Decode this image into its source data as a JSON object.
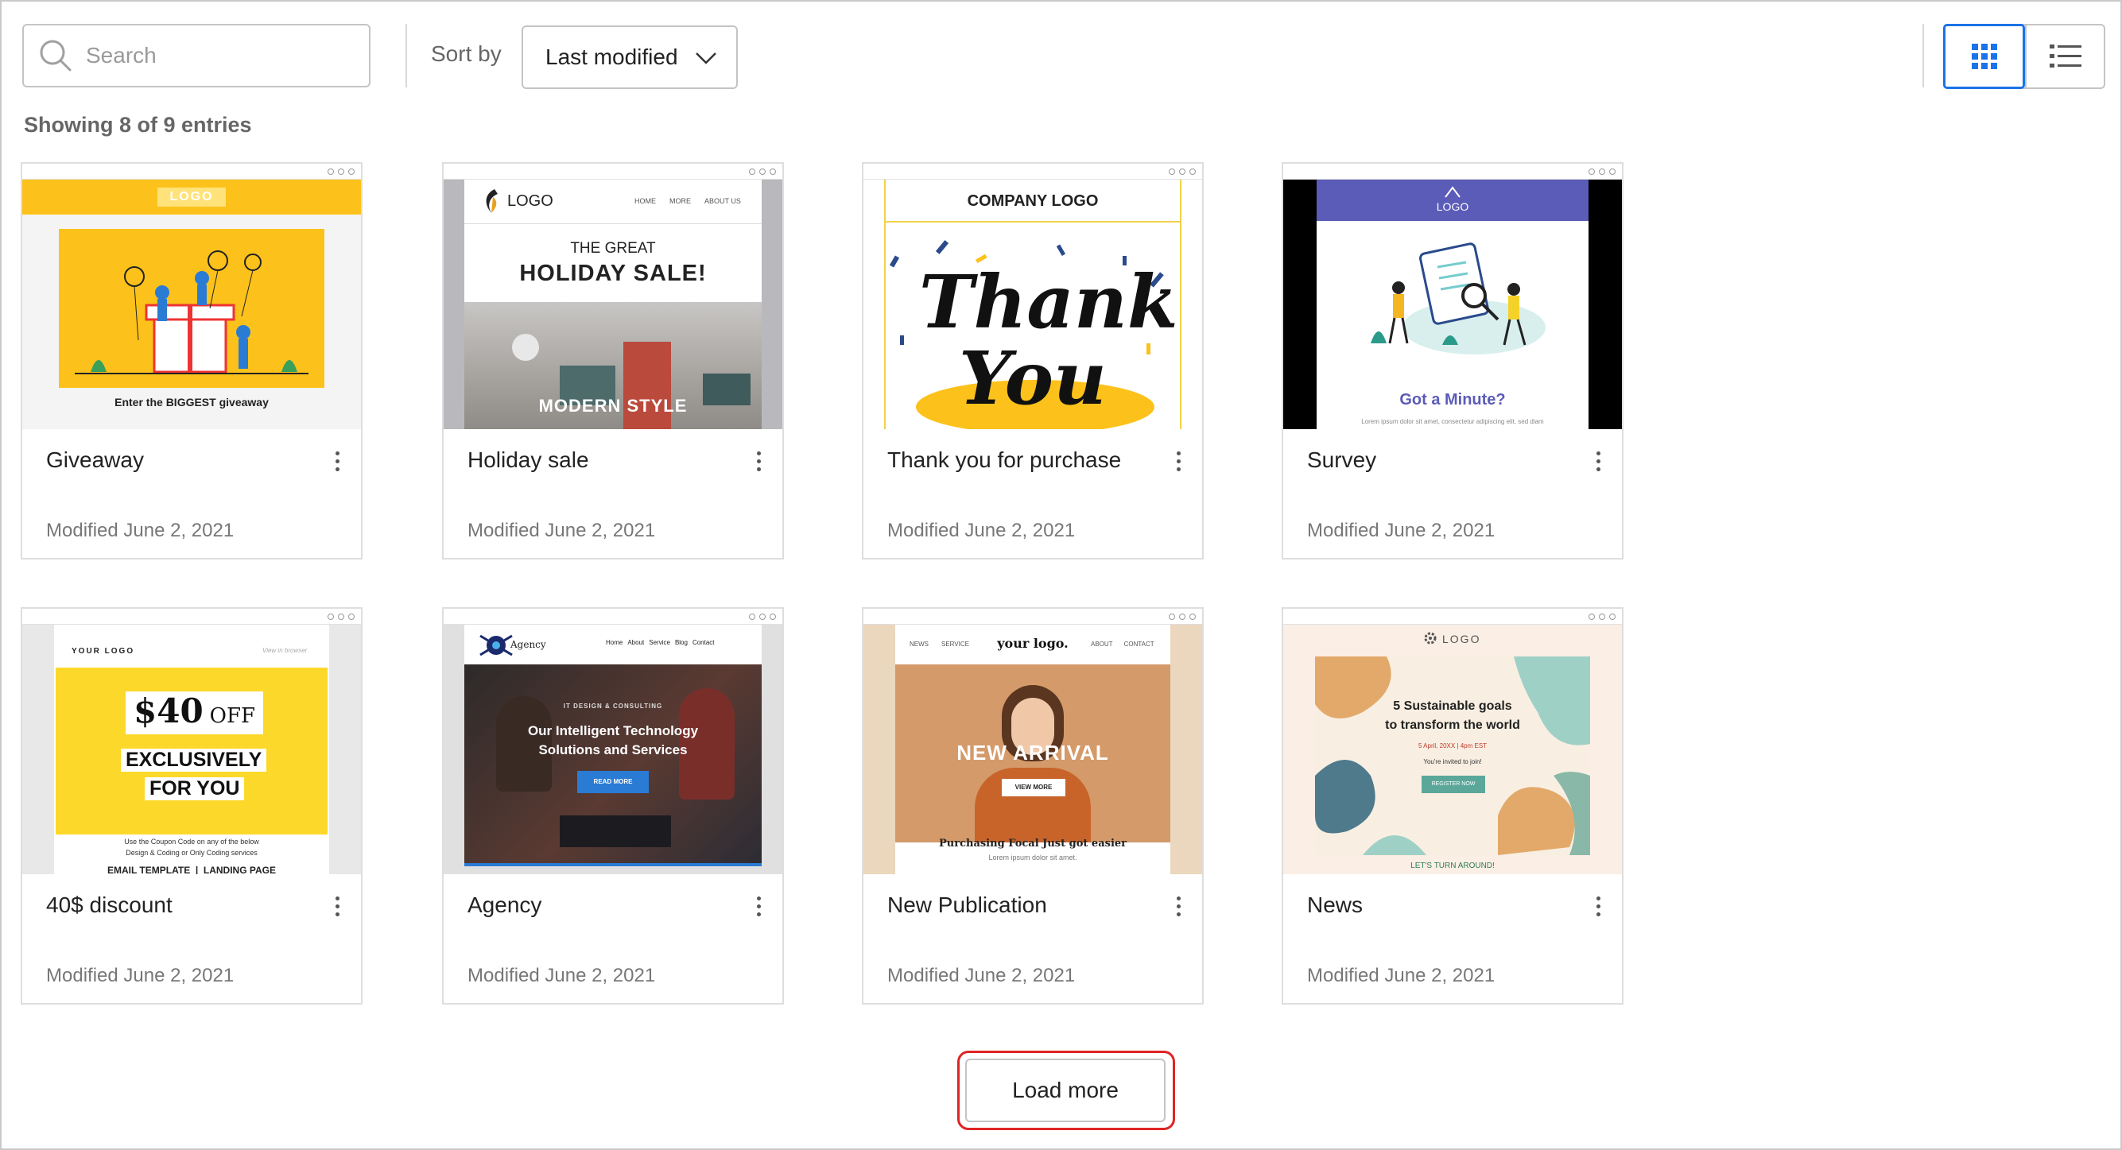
{
  "toolbar": {
    "search_placeholder": "Search",
    "sort_label": "Sort by",
    "sort_value": "Last modified"
  },
  "summary": {
    "count_text": "Showing 8 of 9 entries"
  },
  "colors": {
    "accent": "#1a73e8",
    "highlight": "#e02424"
  },
  "cards": [
    {
      "title": "Giveaway",
      "modified": "Modified June 2, 2021",
      "preview": {
        "logo": "LOGO",
        "caption": "Enter the BIGGEST giveaway"
      }
    },
    {
      "title": "Holiday sale",
      "modified": "Modified June 2, 2021",
      "preview": {
        "logo": "LOGO",
        "nav": [
          "HOME",
          "MORE",
          "ABOUT US"
        ],
        "line1": "THE GREAT",
        "line2": "HOLIDAY SALE!",
        "banner": "MODERN STYLE"
      }
    },
    {
      "title": "Thank you for purchase",
      "modified": "Modified June 2, 2021",
      "preview": {
        "logo": "COMPANY LOGO",
        "word1": "Thank",
        "word2": "You"
      }
    },
    {
      "title": "Survey",
      "modified": "Modified June 2, 2021",
      "preview": {
        "logo": "LOGO",
        "headline": "Got a Minute?",
        "body": "Lorem ipsum dolor sit amet, consectetur adipiscing elit, sed diam"
      }
    },
    {
      "title": "40$ discount",
      "modified": "Modified June 2, 2021",
      "preview": {
        "logo": "YOUR LOGO",
        "link": "View in browser",
        "price": "$40",
        "off": "OFF",
        "line1": "EXCLUSIVELY",
        "line2": "FOR YOU",
        "body1": "Use the Coupon Code on any of the below",
        "body2": "Design & Coding or Only Coding services",
        "footer": "EMAIL TEMPLATE  |  LANDING PAGE"
      }
    },
    {
      "title": "Agency",
      "modified": "Modified June 2, 2021",
      "preview": {
        "logo": "Agency",
        "nav": [
          "Home",
          "About",
          "Service",
          "Blog",
          "Contact"
        ],
        "kicker": "IT DESIGN & CONSULTING",
        "line1": "Our Intelligent Technology",
        "line2": "Solutions and Services",
        "cta": "READ MORE"
      }
    },
    {
      "title": "New Publication",
      "modified": "Modified June 2, 2021",
      "preview": {
        "nav_left": [
          "NEWS",
          "SERVICE"
        ],
        "logo": "your logo.",
        "nav_right": [
          "ABOUT",
          "CONTACT"
        ],
        "headline": "NEW ARRIVAL",
        "cta": "VIEW MORE",
        "caption": "Purchasing Focal Just got easier",
        "body": "Lorem ipsum dolor sit amet."
      }
    },
    {
      "title": "News",
      "modified": "Modified June 2, 2021",
      "preview": {
        "logo": "LOGO",
        "line1": "5 Sustainable goals",
        "line2": "to transform the world",
        "date": "5 April, 20XX | 4pm EST",
        "invite": "You're invited to join!",
        "cta": "REGISTER NOW",
        "footer": "LET'S TURN AROUND!"
      }
    }
  ],
  "load_more_label": "Load more"
}
